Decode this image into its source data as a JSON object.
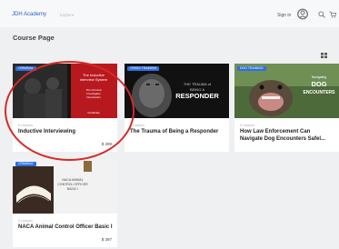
{
  "header": {
    "brand": "JDH Academy",
    "nav_link": "Explore",
    "sign_in": "Sign in"
  },
  "page": {
    "title": "Course Page"
  },
  "courses": [
    {
      "tag": "CRIMINAL",
      "image_text": [
        "The Inductive",
        "Interview System",
        "The Criminal",
        "Investigator",
        "Introduction",
        "Certificate"
      ],
      "kicker": "5 Lessons",
      "title": "Inductive Interviewing",
      "price": "$ 299"
    },
    {
      "tag": "CRISIS TRAINING",
      "image_text": [
        "THE TRAUMA of",
        "BEING A",
        "RESPONDER"
      ],
      "kicker": "5 Lessons",
      "title": "The Trauma of Being a Responder",
      "price": ""
    },
    {
      "tag": "DOG TRAINING",
      "image_text": [
        "Navigating",
        "DOG",
        "ENCOUNTERS"
      ],
      "kicker": "5 Lessons",
      "title": "How Law Enforcement Can Navigate Dog Encounters Safel...",
      "price": ""
    },
    {
      "tag": "CRIMINAL",
      "image_text": [
        "NACA ANIMAL",
        "CONTROL OFFICER",
        "BASIC I"
      ],
      "kicker": "5 Lessons",
      "title": "NACA Animal Control Officer Basic I",
      "price": "$ 397"
    }
  ],
  "colors": {
    "accent": "#2b61c4",
    "tag": "#2f6fe0",
    "annotation_circle": "#d42a2a"
  },
  "icons": [
    "user-avatar-icon",
    "search-icon",
    "cart-icon",
    "grid-view-icon"
  ]
}
